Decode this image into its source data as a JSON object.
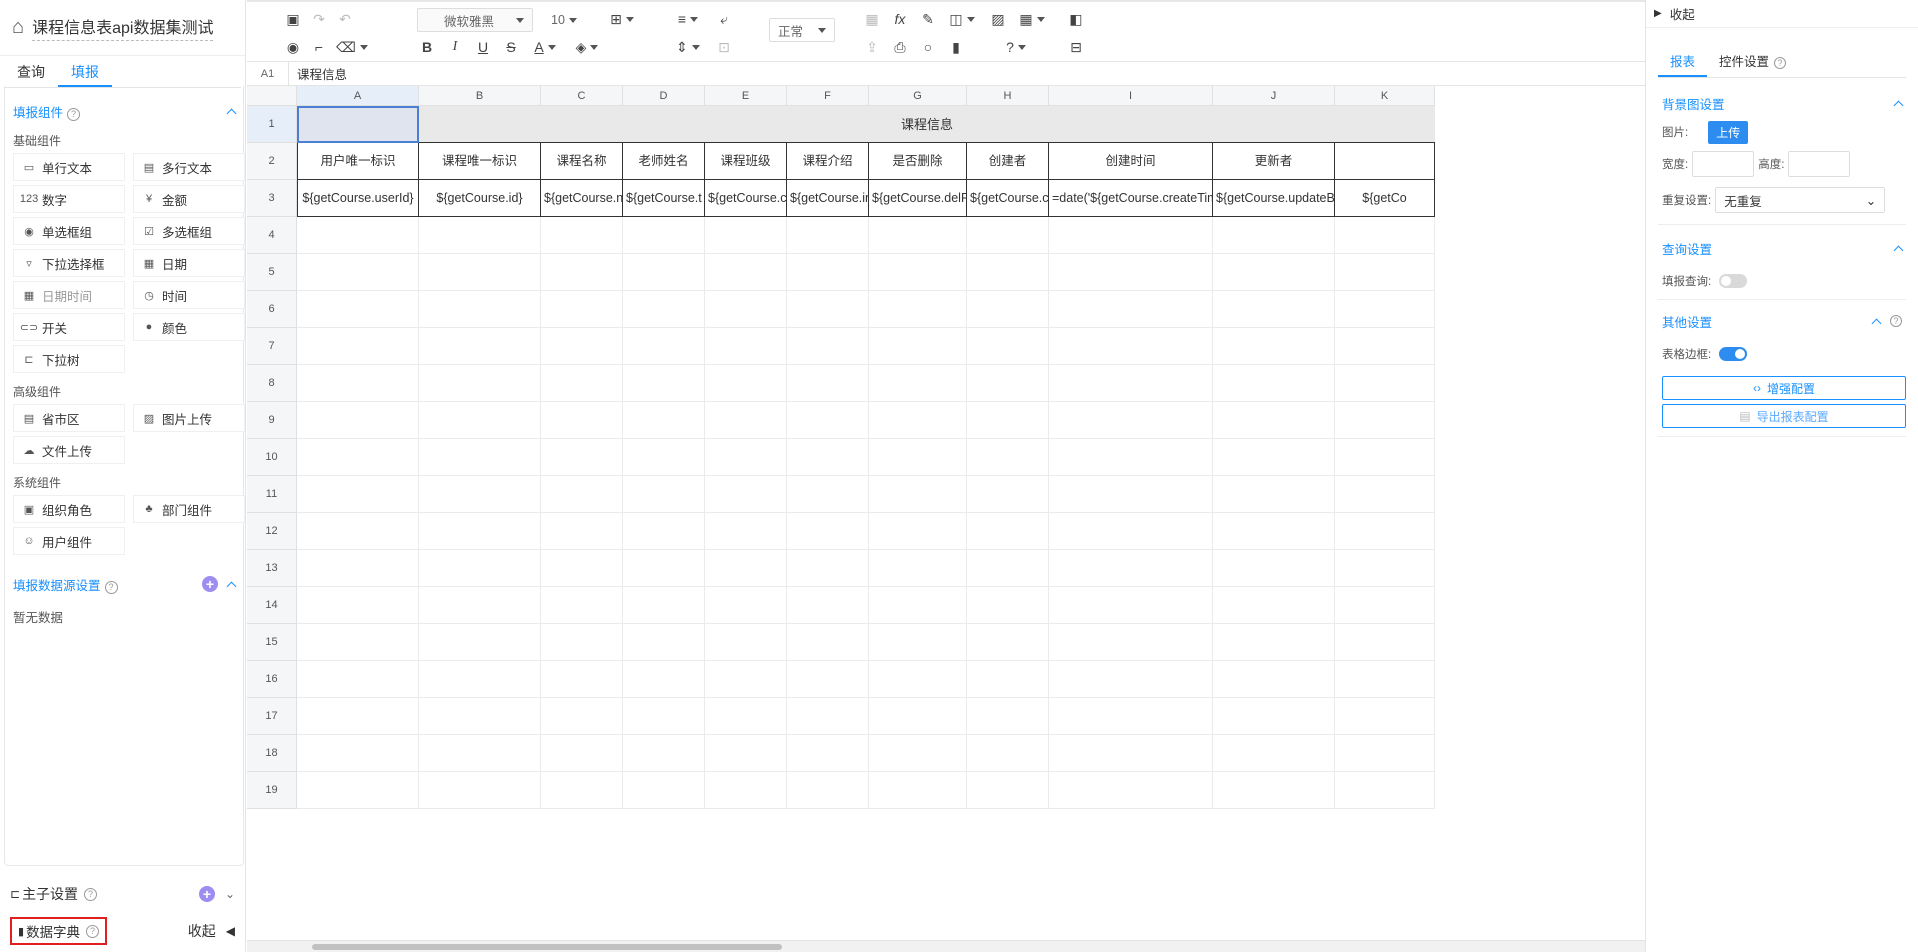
{
  "left": {
    "title": "课程信息表api数据集测试",
    "tabs": [
      "查询",
      "填报"
    ],
    "fill_section": "填报组件",
    "groups": [
      {
        "label": "基础组件",
        "items": [
          {
            "label": "单行文本",
            "icon": "single-line-text-icon",
            "glyph": "▭"
          },
          {
            "label": "多行文本",
            "icon": "multi-line-text-icon",
            "glyph": "▤"
          },
          {
            "label": "数字",
            "icon": "number-icon",
            "glyph": "123"
          },
          {
            "label": "金额",
            "icon": "money-icon",
            "glyph": "¥"
          },
          {
            "label": "单选框组",
            "icon": "radio-icon",
            "glyph": "◉"
          },
          {
            "label": "多选框组",
            "icon": "checkbox-icon",
            "glyph": "☑"
          },
          {
            "label": "下拉选择框",
            "icon": "dropdown-icon",
            "glyph": "▿"
          },
          {
            "label": "日期",
            "icon": "calendar-icon",
            "glyph": "▦"
          },
          {
            "label": "日期时间",
            "icon": "datetime-icon",
            "glyph": "▦"
          },
          {
            "label": "时间",
            "icon": "clock-icon",
            "glyph": "◷"
          },
          {
            "label": "开关",
            "icon": "switch-icon",
            "glyph": "⊂⊃"
          },
          {
            "label": "颜色",
            "icon": "palette-icon",
            "glyph": "●"
          },
          {
            "label": "下拉树",
            "icon": "tree-icon",
            "glyph": "⊏"
          }
        ]
      },
      {
        "label": "高级组件",
        "items": [
          {
            "label": "省市区",
            "icon": "region-icon",
            "glyph": "▤"
          },
          {
            "label": "图片上传",
            "icon": "image-upload-icon",
            "glyph": "▨"
          },
          {
            "label": "文件上传",
            "icon": "file-upload-icon",
            "glyph": "☁"
          }
        ]
      },
      {
        "label": "系统组件",
        "items": [
          {
            "label": "组织角色",
            "icon": "org-role-icon",
            "glyph": "▣"
          },
          {
            "label": "部门组件",
            "icon": "department-icon",
            "glyph": "♣"
          },
          {
            "label": "用户组件",
            "icon": "user-icon",
            "glyph": "☺"
          }
        ]
      }
    ],
    "datasource_section": "填报数据源设置",
    "no_data": "暂无数据",
    "main_sub": "主子设置",
    "dict": "数据字典",
    "collapse": "收起"
  },
  "toolbar": {
    "font": "微软雅黑",
    "size": "10",
    "style": "正常"
  },
  "formula": {
    "ref": "A1",
    "value": "课程信息"
  },
  "grid": {
    "columns": [
      {
        "label": "A",
        "w": 122
      },
      {
        "label": "B",
        "w": 122
      },
      {
        "label": "C",
        "w": 82
      },
      {
        "label": "D",
        "w": 82
      },
      {
        "label": "E",
        "w": 82
      },
      {
        "label": "F",
        "w": 82
      },
      {
        "label": "G",
        "w": 98
      },
      {
        "label": "H",
        "w": 82
      },
      {
        "label": "I",
        "w": 164
      },
      {
        "label": "J",
        "w": 122
      },
      {
        "label": "K",
        "w": 100
      }
    ],
    "rows": [
      "1",
      "2",
      "3",
      "4",
      "5",
      "6",
      "7",
      "8",
      "9",
      "10",
      "11",
      "12",
      "13",
      "14",
      "15",
      "16",
      "17",
      "18",
      "19"
    ],
    "title": "课程信息",
    "headers": [
      "用户唯一标识",
      "课程唯一标识",
      "课程名称",
      "老师姓名",
      "课程班级",
      "课程介绍",
      "是否删除",
      "创建者",
      "创建时间",
      "更新者",
      ""
    ],
    "bindings": [
      "${getCourse.userId}",
      "${getCourse.id}",
      "${getCourse.n",
      "${getCourse.t",
      "${getCourse.c",
      "${getCourse.in",
      "${getCourse.delFl",
      "${getCourse.cr",
      "=date('${getCourse.createTim",
      "${getCourse.updateBy",
      "${getCo"
    ]
  },
  "right": {
    "collapse": "收起",
    "tabs": [
      "报表",
      "控件设置"
    ],
    "bg_section": "背景图设置",
    "image_label": "图片:",
    "upload": "上传",
    "width_label": "宽度:",
    "height_label": "高度:",
    "repeat_label": "重复设置:",
    "repeat_value": "无重复",
    "query_section": "查询设置",
    "fill_query_label": "填报查询:",
    "other_section": "其他设置",
    "border_label": "表格边框:",
    "enhance_btn": "增强配置",
    "export_btn": "导出报表配置"
  }
}
